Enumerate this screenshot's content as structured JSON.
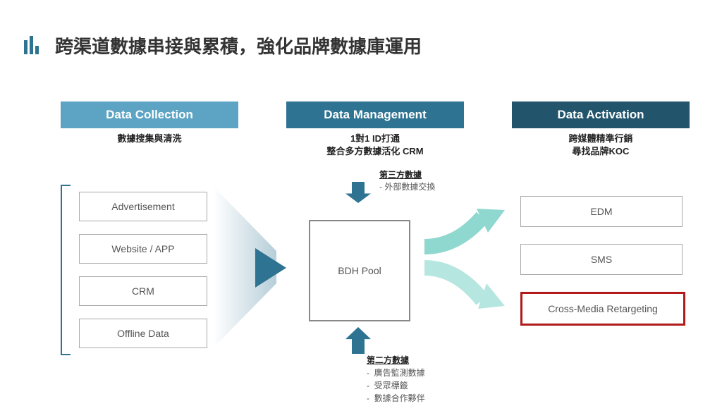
{
  "title": "跨渠道數據串接與累積，強化品牌數據庫運用",
  "columns": {
    "c1": {
      "head": "Data Collection",
      "sub": "數據搜集與清洗"
    },
    "c2": {
      "head": "Data Management",
      "sub": "1對1 ID打通\n整合多方數據活化 CRM"
    },
    "c3": {
      "head": "Data Activation",
      "sub": "跨媒體精準行銷\n尋找品牌KOC"
    }
  },
  "left_boxes": [
    "Advertisement",
    "Website / APP",
    "CRM",
    "Offline Data"
  ],
  "center_box": "BDH Pool",
  "third_party": {
    "hd": "第三方數據",
    "lines": [
      "外部數據交換"
    ]
  },
  "second_party": {
    "hd": "第二方數據",
    "lines": [
      "廣告監測數據",
      "受眾標籤",
      "數據合作夥伴"
    ]
  },
  "right_boxes": [
    "EDM",
    "SMS",
    "Cross-Media Retargeting"
  ],
  "colors": {
    "teal_dark": "#2f7392",
    "teal_mid": "#5da4c4",
    "teal_light": "#7fd0c7",
    "highlight": "#b11a1a"
  }
}
